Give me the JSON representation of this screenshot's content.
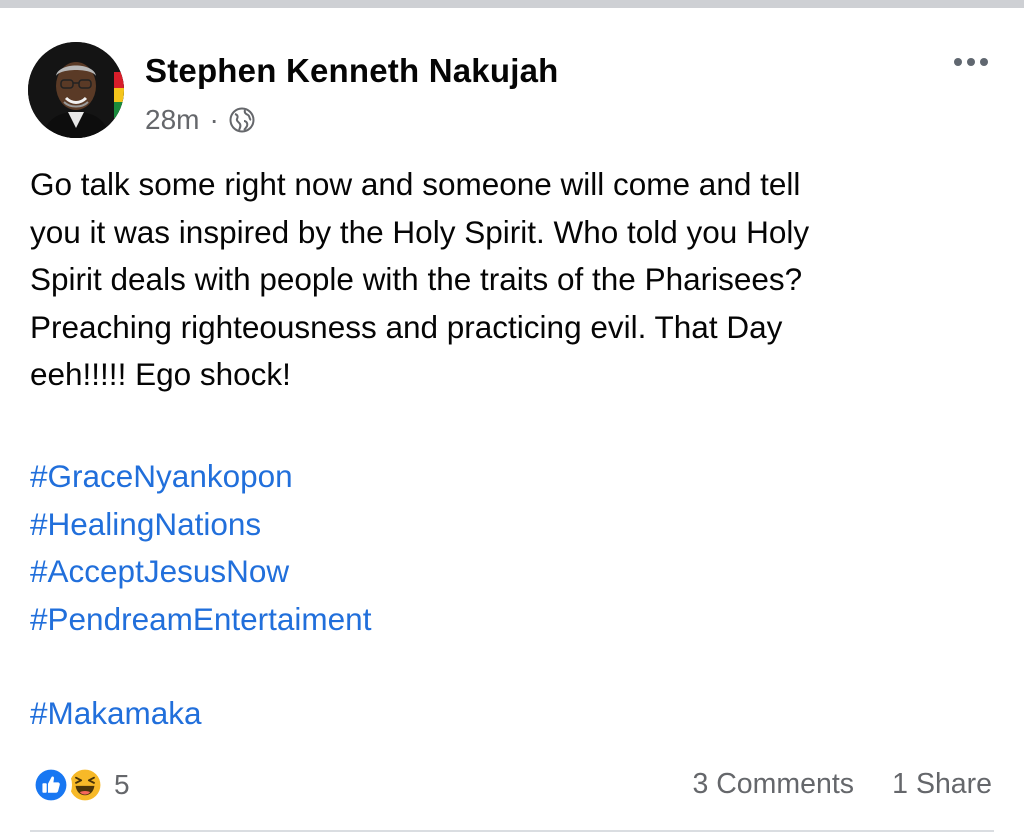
{
  "post": {
    "author": "Stephen Kenneth Nakujah",
    "time": "28m",
    "separator": "·",
    "privacy_icon": "globe-icon",
    "more_icon": "more-options-icon",
    "text_lines": [
      "Go talk some right now and someone will come and tell",
      "you it was inspired by the Holy Spirit. Who told you Holy",
      "Spirit deals with people with the traits of the Pharisees?",
      "Preaching righteousness and practicing evil. That Day",
      "eeh!!!!! Ego shock!"
    ],
    "hashtags": [
      "#GraceNyankopon",
      "#HealingNations",
      "#AcceptJesusNow",
      "#PendreamEntertaiment"
    ],
    "hashtag_last": "#Makamaka"
  },
  "footer": {
    "reaction_icons": [
      "like-icon",
      "haha-icon"
    ],
    "reaction_count": "5",
    "comments": "3 Comments",
    "shares": "1 Share"
  },
  "colors": {
    "link": "#216fdb",
    "secondary_text": "#65676b",
    "like_blue": "#1877f2",
    "haha_yellow": "#f7b928"
  }
}
